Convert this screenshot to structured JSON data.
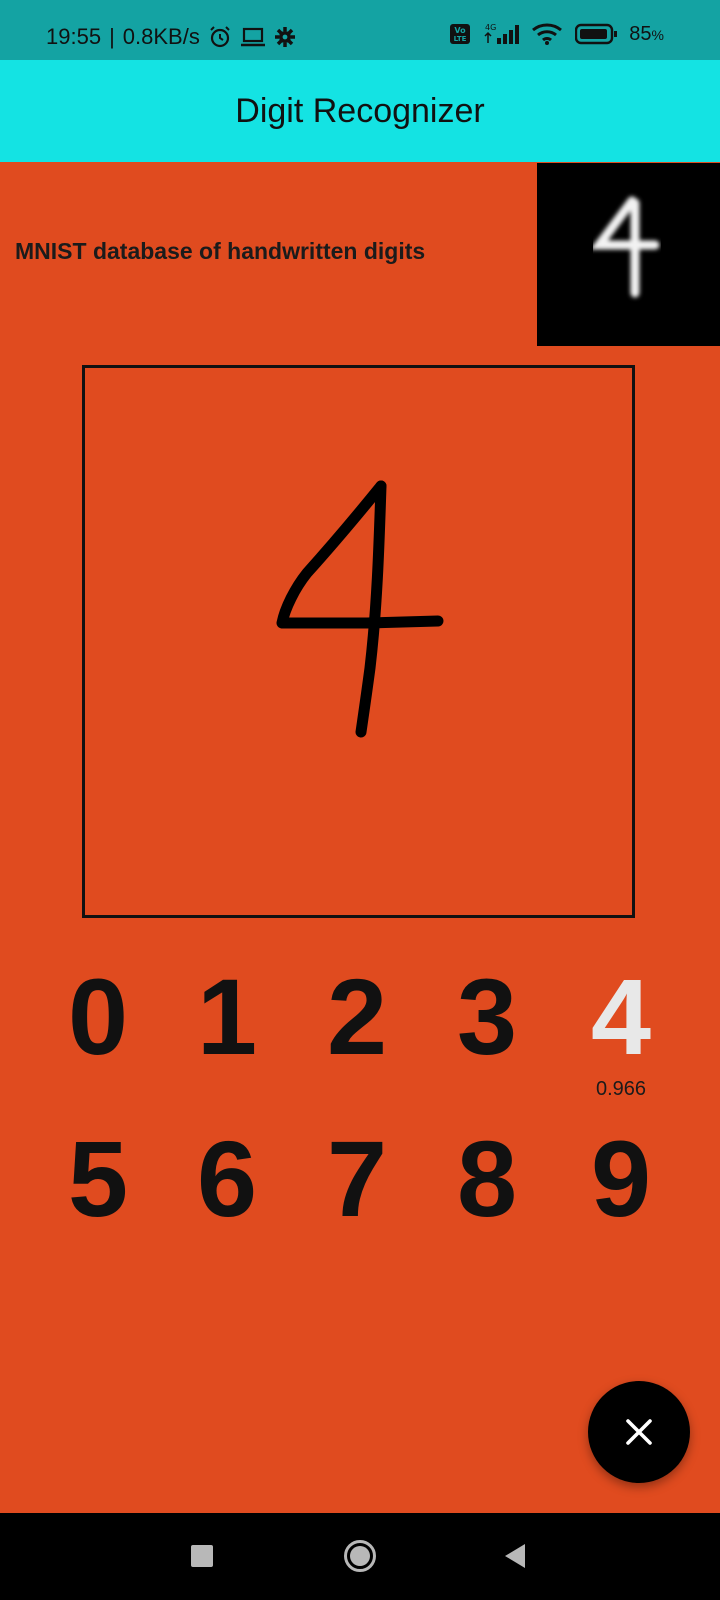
{
  "status_bar": {
    "time": "19:55",
    "separator": "|",
    "speed": "0.8KB/s",
    "battery_percent": "85",
    "battery_sign": "%",
    "network": "4G",
    "volte": "Vo LTE"
  },
  "app_bar": {
    "title": "Digit Recognizer"
  },
  "header": {
    "database_label": "MNIST database of handwritten digits"
  },
  "digits": {
    "row1": [
      "0",
      "1",
      "2",
      "3",
      "4"
    ],
    "row2": [
      "5",
      "6",
      "7",
      "8",
      "9"
    ],
    "predicted": "4",
    "confidence": "0.966"
  },
  "fab": {
    "icon": "close-icon"
  },
  "nav_bar": {
    "icons": [
      "recent-apps-icon",
      "home-icon",
      "back-icon"
    ]
  },
  "colors": {
    "background": "#e04b1f",
    "app_bar": "#14e3e3",
    "status_bar": "#14a3a3",
    "predicted_digit": "#e8e8e8"
  }
}
